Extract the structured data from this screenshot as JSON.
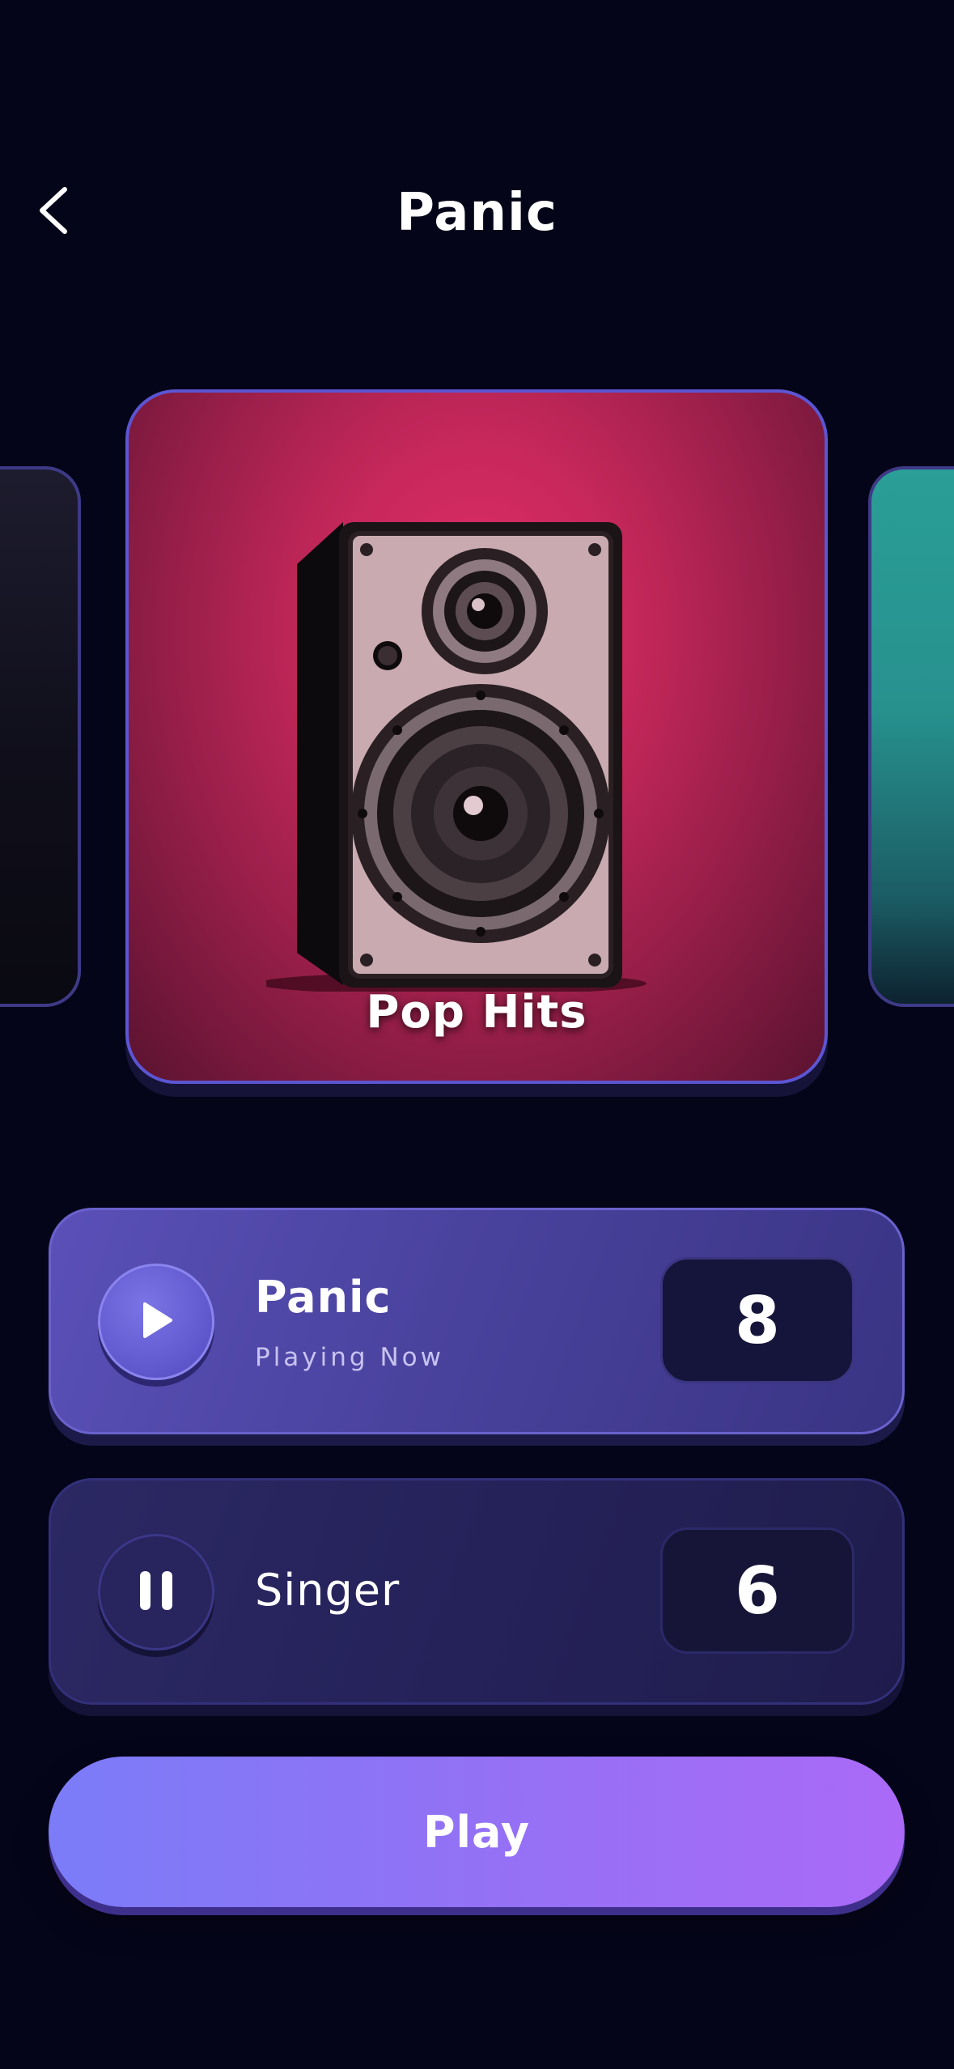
{
  "header": {
    "title": "Panic"
  },
  "carousel": {
    "featured_card": {
      "title": "Pop Hits"
    }
  },
  "tracks": [
    {
      "name": "Panic",
      "status": "Playing Now",
      "count": "8",
      "control_icon": "play-icon"
    },
    {
      "name": "Singer",
      "count": "6",
      "control_icon": "pause-icon"
    }
  ],
  "actions": {
    "play_label": "Play"
  },
  "colors": {
    "background": "#05051a",
    "accent_start": "#7b7cf8",
    "accent_end": "#aa6af7",
    "card_pink": "#e12d68"
  }
}
